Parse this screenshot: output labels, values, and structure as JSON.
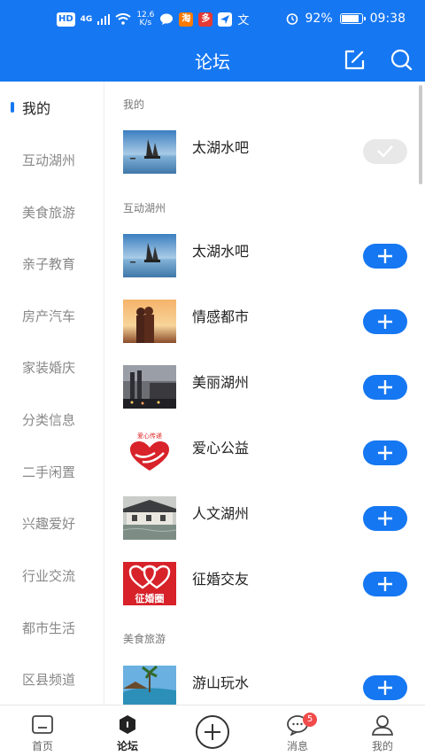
{
  "status_bar": {
    "left_badges": [
      "HD",
      "4G"
    ],
    "speed": "12.6",
    "speed_unit": "K/s",
    "app_icon_labels": [
      "淘",
      "多",
      "文"
    ],
    "battery": "92%",
    "battery_level": 0.92,
    "time": "09:38"
  },
  "header": {
    "title": "论坛"
  },
  "sidebar": {
    "items": [
      {
        "label": "我的",
        "active": true
      },
      {
        "label": "互动湖州"
      },
      {
        "label": "美食旅游"
      },
      {
        "label": "亲子教育"
      },
      {
        "label": "房产汽车"
      },
      {
        "label": "家装婚庆"
      },
      {
        "label": "分类信息"
      },
      {
        "label": "二手闲置"
      },
      {
        "label": "兴趣爱好"
      },
      {
        "label": "行业交流"
      },
      {
        "label": "都市生活"
      },
      {
        "label": "区县频道"
      }
    ]
  },
  "content": {
    "sections": [
      {
        "header": "我的",
        "items": [
          {
            "title": "太湖水吧",
            "joined": true
          }
        ]
      },
      {
        "header": "互动湖州",
        "items": [
          {
            "title": "太湖水吧",
            "joined": false
          },
          {
            "title": "情感都市",
            "joined": false
          },
          {
            "title": "美丽湖州",
            "joined": false
          },
          {
            "title": "爱心公益",
            "joined": false
          },
          {
            "title": "人文湖州",
            "joined": false
          },
          {
            "title": "征婚交友",
            "joined": false
          }
        ]
      },
      {
        "header": "美食旅游",
        "items": [
          {
            "title": "游山玩水",
            "joined": false
          }
        ]
      }
    ],
    "thumb_texts": {
      "charity": "爱心传递",
      "marriage": "征婚圈"
    }
  },
  "bottom_nav": {
    "items": [
      {
        "label": "首页",
        "icon": "home-icon"
      },
      {
        "label": "论坛",
        "icon": "forum-icon",
        "active": true
      },
      {
        "label": "",
        "icon": "add-circle-icon"
      },
      {
        "label": "消息",
        "icon": "message-icon",
        "badge": "5"
      },
      {
        "label": "我的",
        "icon": "profile-icon"
      }
    ]
  },
  "colors": {
    "brand": "#1677f2",
    "badge": "#f04a4a"
  }
}
